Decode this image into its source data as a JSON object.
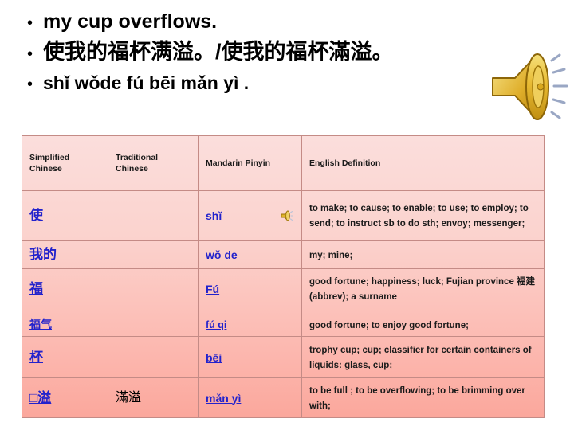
{
  "slide": {
    "bullets": [
      {
        "id": "english-sentence",
        "text": "my cup overflows."
      },
      {
        "id": "chinese-sentence",
        "text": "使我的福杯满溢。/使我的福杯滿溢。"
      },
      {
        "id": "pinyin-sentence",
        "text": "shǐ wǒde fú bēi mǎn yì ."
      }
    ],
    "bullet_marker": "•"
  },
  "audio": {
    "large_speaker_icon": "speaker-icon",
    "small_speaker_icon": "speaker-icon"
  },
  "table": {
    "headers": [
      "Simplified Chinese",
      "Traditional Chinese",
      "Mandarin Pinyin",
      "English Definition"
    ],
    "rows": [
      {
        "simplified": "使",
        "traditional": "",
        "pinyin": "shǐ",
        "has_audio": true,
        "english": "to make; to cause; to enable; to use; to employ; to send; to instruct sb to do sth; envoy; messenger;"
      },
      {
        "simplified": "我的",
        "traditional": "",
        "pinyin": "wǒ de",
        "has_audio": false,
        "english": "my; mine;"
      },
      {
        "simplified": "福",
        "traditional": "",
        "pinyin": "Fú",
        "has_audio": false,
        "english": "good fortune; happiness; luck; Fujian province 福建(abbrev); a surname"
      },
      {
        "simplified": "福气",
        "traditional": "",
        "pinyin": "fú qi",
        "has_audio": false,
        "english": "good fortune; to enjoy good fortune;"
      },
      {
        "simplified": "杯",
        "traditional": "",
        "pinyin": "bēi",
        "has_audio": false,
        "english": "trophy cup; cup; classifier for certain containers of liquids: glass, cup;"
      },
      {
        "simplified": "□溢",
        "traditional": "滿溢",
        "pinyin": "mǎn yì",
        "has_audio": false,
        "english": "to be full ;  to be overflowing; to be brimming over with;"
      }
    ]
  },
  "colors": {
    "link": "#2222cc",
    "table_border": "#c48b86",
    "table_top": "#fbdedc",
    "table_bottom": "#fba79c",
    "speaker_gold": "#e8b730"
  }
}
